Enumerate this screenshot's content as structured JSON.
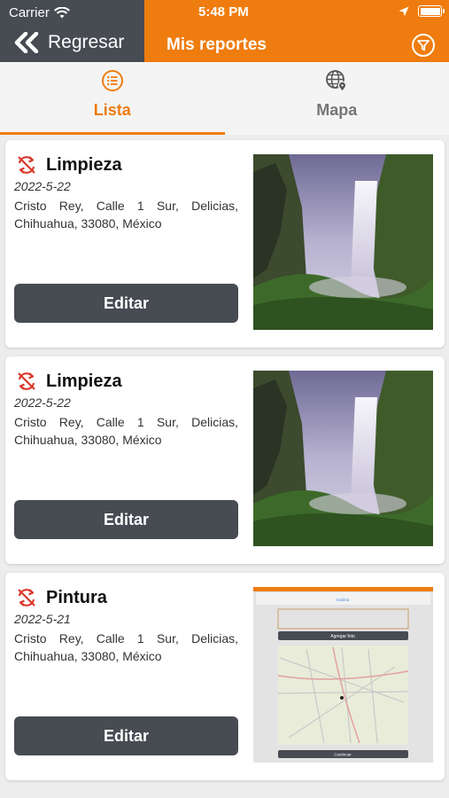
{
  "status_bar": {
    "carrier": "Carrier",
    "time": "5:48 PM"
  },
  "header": {
    "back_label": "Regresar",
    "title": "Mis reportes"
  },
  "tabs": [
    {
      "label": "Lista",
      "active": true
    },
    {
      "label": "Mapa",
      "active": false
    }
  ],
  "reports": [
    {
      "type": "Limpieza",
      "date": "2022-5-22",
      "address": "Cristo Rey, Calle 1 Sur, Delicias, Chihuahua, 33080, México",
      "button": "Editar",
      "image": "waterfall-photo"
    },
    {
      "type": "Limpieza",
      "date": "2022-5-22",
      "address": "Cristo Rey, Calle 1 Sur, Delicias, Chihuahua, 33080, México",
      "button": "Editar",
      "image": "waterfall-photo"
    },
    {
      "type": "Pintura",
      "date": "2022-5-21",
      "address": "Cristo Rey, Calle 1 Sur, Delicias, Chihuahua, 33080, México",
      "button": "Editar",
      "image": "map-screenshot",
      "image_texts": {
        "tab": "Galería",
        "button1": "Agregar foto",
        "button2": "Continuar"
      }
    }
  ],
  "colors": {
    "accent": "#ef7c0e",
    "dark": "#474b52",
    "report_icon": "#d9382a"
  }
}
